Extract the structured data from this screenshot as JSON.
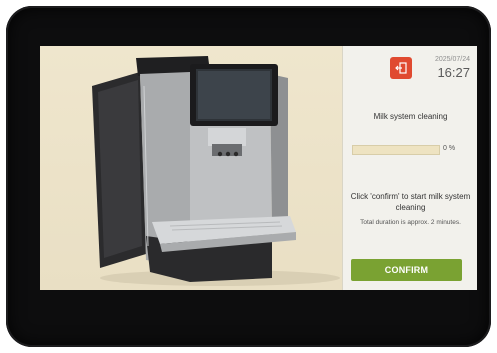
{
  "status": {
    "date": "2025/07/24",
    "time": "16:27",
    "exit_icon": "exit-icon"
  },
  "cleaning": {
    "title": "Milk system cleaning",
    "progress_fraction": 0,
    "progress_label": "0 %",
    "message": "Click 'confirm' to start milk system cleaning",
    "duration_note": "Total duration is approx. 2 minutes.",
    "confirm_label": "CONFIRM"
  },
  "image": {
    "subject": "coffee-machine"
  },
  "colors": {
    "accent_green": "#7aa232",
    "exit_red": "#e04a30",
    "screen_bg": "#ece2c9"
  }
}
